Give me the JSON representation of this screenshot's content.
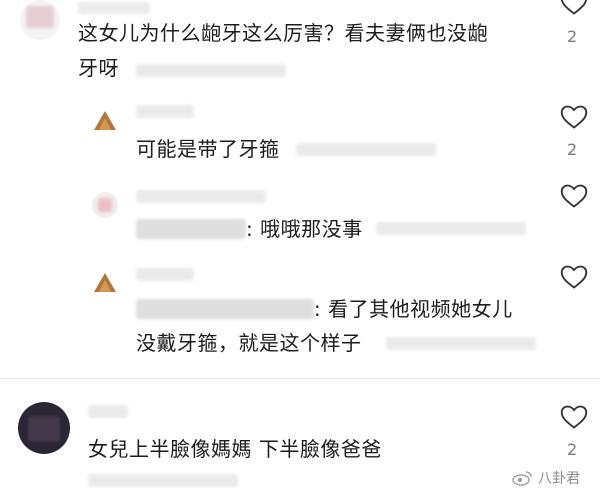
{
  "comments": [
    {
      "id": "c1",
      "text_line1": "这女儿为什么龅牙这么厉害？看夫妻俩也没龅",
      "text_line2": "牙呀",
      "likes": "2"
    },
    {
      "id": "c2",
      "text": "可能是带了牙箍",
      "likes": "2"
    },
    {
      "id": "c3",
      "text": ": 哦哦那没事",
      "likes": ""
    },
    {
      "id": "c4",
      "text_line1": ": 看了其他视频她女儿",
      "text_line2": "没戴牙箍，就是这个样子",
      "likes": ""
    },
    {
      "id": "c5",
      "text": "女兒上半臉像媽媽  下半臉像爸爸",
      "likes": "2"
    }
  ],
  "watermark": {
    "text": "八卦君"
  },
  "colors": {
    "text": "#1c1c1c",
    "count": "#7a7a7a",
    "icon": "#333333",
    "divider": "#e6e6e6"
  }
}
